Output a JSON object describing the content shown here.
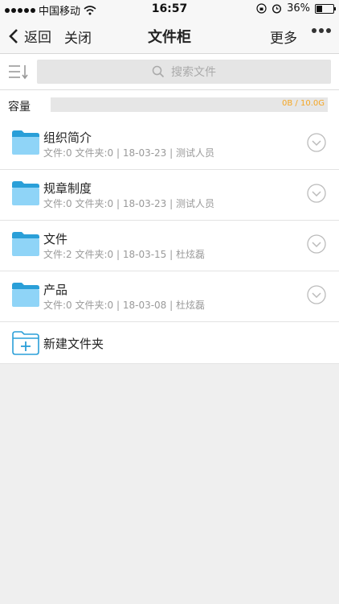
{
  "status_bar": {
    "carrier": "中国移动",
    "time": "16:57",
    "battery": "36%"
  },
  "nav": {
    "back_label": "返回",
    "close_label": "关闭",
    "title": "文件柜",
    "more_label": "更多"
  },
  "search": {
    "placeholder": "搜索文件"
  },
  "capacity": {
    "label": "容量",
    "usage_text": "0B / 10.0G",
    "used_fraction": 0
  },
  "folders": [
    {
      "name": "组织简介",
      "meta": "文件:0 文件夹:0 | 18-03-23 | 测试人员"
    },
    {
      "name": "规章制度",
      "meta": "文件:0 文件夹:0 | 18-03-23 | 测试人员"
    },
    {
      "name": "文件",
      "meta": "文件:2 文件夹:0 | 18-03-15 | 杜炫磊"
    },
    {
      "name": "产品",
      "meta": "文件:0 文件夹:0 | 18-03-08 | 杜炫磊"
    }
  ],
  "new_folder_label": "新建文件夹",
  "colors": {
    "folder_light": "#8fd4f7",
    "folder_dark": "#2a9fd8",
    "capacity_text": "#f5a623"
  }
}
